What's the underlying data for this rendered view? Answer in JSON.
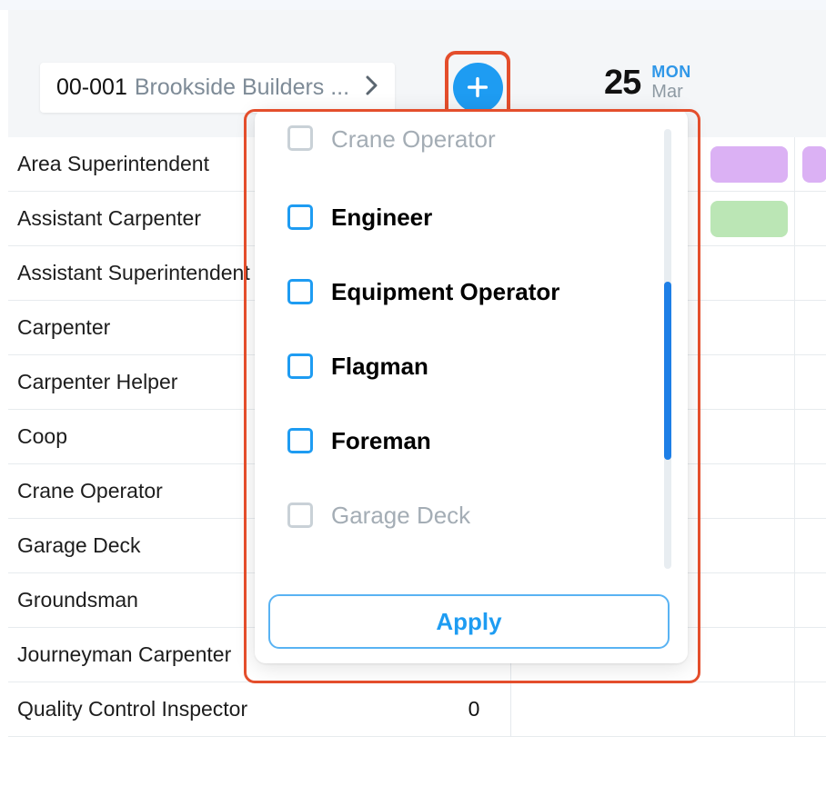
{
  "header": {
    "project_code": "00-001",
    "project_name": "Brookside Builders ...",
    "date_number": "25",
    "date_dow": "MON",
    "date_month": "Mar"
  },
  "list": {
    "rows": [
      {
        "label": "Area Superintendent"
      },
      {
        "label": "Assistant Carpenter"
      },
      {
        "label": "Assistant Superintendent"
      },
      {
        "label": "Carpenter"
      },
      {
        "label": "Carpenter Helper"
      },
      {
        "label": "Coop"
      },
      {
        "label": "Crane Operator"
      },
      {
        "label": "Garage Deck"
      },
      {
        "label": "Groundsman"
      },
      {
        "label": "Journeyman Carpenter"
      },
      {
        "label": "Quality Control Inspector",
        "count": "0"
      }
    ]
  },
  "popup": {
    "options": [
      {
        "label": "Crane Operator",
        "enabled": false
      },
      {
        "label": "Engineer",
        "enabled": true
      },
      {
        "label": "Equipment Operator",
        "enabled": true
      },
      {
        "label": "Flagman",
        "enabled": true
      },
      {
        "label": "Foreman",
        "enabled": true
      },
      {
        "label": "Garage Deck",
        "enabled": false
      }
    ],
    "apply_label": "Apply"
  }
}
